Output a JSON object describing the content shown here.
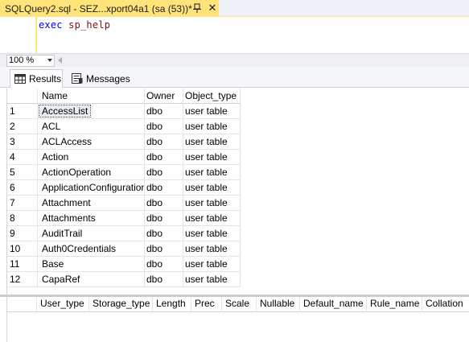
{
  "document_tab": {
    "title": "SQLQuery2.sql - SEZ...xport04a1 (sa (53))*",
    "close_glyph": "✕"
  },
  "editor": {
    "keyword": "exec",
    "identifier": "sp_help"
  },
  "zoom": {
    "value": "100 %"
  },
  "results_tabs": {
    "results_label": "Results",
    "messages_label": "Messages"
  },
  "grid1": {
    "columns": {
      "name": "Name",
      "owner": "Owner",
      "type": "Object_type"
    },
    "rows": [
      {
        "n": "1",
        "name": "AccessList",
        "owner": "dbo",
        "type": "user table"
      },
      {
        "n": "2",
        "name": "ACL",
        "owner": "dbo",
        "type": "user table"
      },
      {
        "n": "3",
        "name": "ACLAccess",
        "owner": "dbo",
        "type": "user table"
      },
      {
        "n": "4",
        "name": "Action",
        "owner": "dbo",
        "type": "user table"
      },
      {
        "n": "5",
        "name": "ActionOperation",
        "owner": "dbo",
        "type": "user table"
      },
      {
        "n": "6",
        "name": "ApplicationConfiguration",
        "owner": "dbo",
        "type": "user table"
      },
      {
        "n": "7",
        "name": "Attachment",
        "owner": "dbo",
        "type": "user table"
      },
      {
        "n": "8",
        "name": "Attachments",
        "owner": "dbo",
        "type": "user table"
      },
      {
        "n": "9",
        "name": "AuditTrail",
        "owner": "dbo",
        "type": "user table"
      },
      {
        "n": "10",
        "name": "Auth0Credentials",
        "owner": "dbo",
        "type": "user table"
      },
      {
        "n": "11",
        "name": "Base",
        "owner": "dbo",
        "type": "user table"
      },
      {
        "n": "12",
        "name": "CapaRef",
        "owner": "dbo",
        "type": "user table"
      }
    ]
  },
  "grid2": {
    "columns": [
      "User_type",
      "Storage_type",
      "Length",
      "Prec",
      "Scale",
      "Nullable",
      "Default_name",
      "Rule_name",
      "Collation"
    ]
  },
  "colors": {
    "tab_accent": "#ffe47a",
    "keyword": "#0000ff",
    "identifier": "#7a1010"
  }
}
